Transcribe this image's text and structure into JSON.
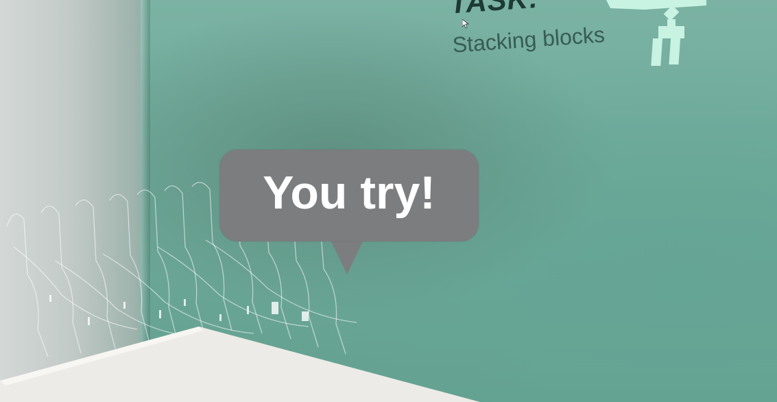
{
  "task": {
    "title": "TASK:",
    "subtitle": "Stacking blocks"
  },
  "bubble": {
    "message": "You try!"
  },
  "icons": {
    "robot": "robot-gripper-icon",
    "cursor": "mouse-cursor-icon",
    "hands": "ghost-hands-trail"
  },
  "colors": {
    "wall": "#6fa799",
    "bubble": "#7b7d7f",
    "title": "#1d3a33",
    "robot": "#c8f2e2"
  }
}
